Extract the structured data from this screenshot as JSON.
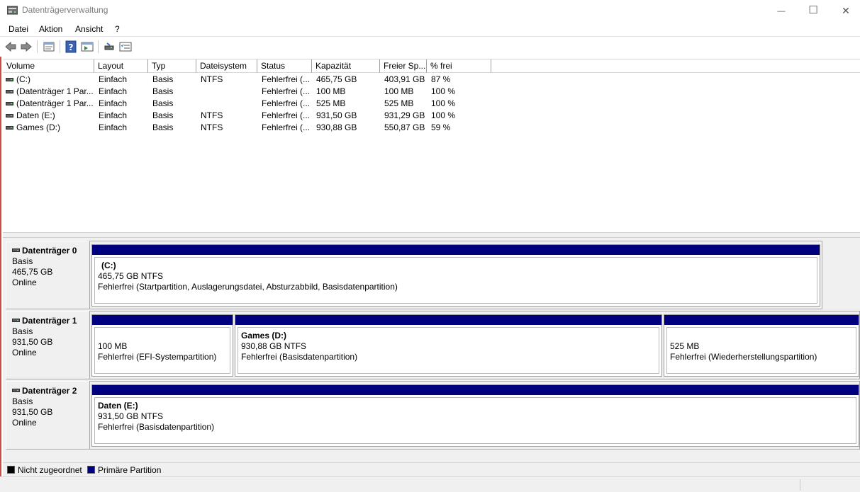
{
  "window": {
    "title": "Datenträgerverwaltung",
    "controls": {
      "minimize": "—",
      "maximize": "☐",
      "close": "✕"
    }
  },
  "menu": [
    {
      "label": "Datei"
    },
    {
      "label": "Aktion"
    },
    {
      "label": "Ansicht"
    },
    {
      "label": "?"
    }
  ],
  "toolbar": [
    "back-icon",
    "forward-icon",
    "properties-icon",
    "help-icon",
    "show-hide-console-tree-icon",
    "connect-icon",
    "checklist-icon"
  ],
  "volume_list": {
    "columns": [
      "Volume",
      "Layout",
      "Typ",
      "Dateisystem",
      "Status",
      "Kapazität",
      "Freier Sp...",
      "% frei"
    ],
    "rows": [
      {
        "volume": " (C:)",
        "layout": "Einfach",
        "typ": "Basis",
        "fs": "NTFS",
        "status": "Fehlerfrei (...",
        "capacity": "465,75 GB",
        "free": "403,91 GB",
        "pct": "87 %"
      },
      {
        "volume": "(Datenträger 1 Par...",
        "layout": "Einfach",
        "typ": "Basis",
        "fs": "",
        "status": "Fehlerfrei (...",
        "capacity": "100 MB",
        "free": "100 MB",
        "pct": "100 %"
      },
      {
        "volume": "(Datenträger 1 Par...",
        "layout": "Einfach",
        "typ": "Basis",
        "fs": "",
        "status": "Fehlerfrei (...",
        "capacity": "525 MB",
        "free": "525 MB",
        "pct": "100 %"
      },
      {
        "volume": "Daten (E:)",
        "layout": "Einfach",
        "typ": "Basis",
        "fs": "NTFS",
        "status": "Fehlerfrei (...",
        "capacity": "931,50 GB",
        "free": "931,29 GB",
        "pct": "100 %"
      },
      {
        "volume": "Games (D:)",
        "layout": "Einfach",
        "typ": "Basis",
        "fs": "NTFS",
        "status": "Fehlerfrei (...",
        "capacity": "930,88 GB",
        "free": "550,87 GB",
        "pct": "59 %"
      }
    ]
  },
  "disks": [
    {
      "name": "Datenträger 0",
      "type": "Basis",
      "size": "465,75 GB",
      "state": "Online",
      "partitions": [
        {
          "name": "(C:)",
          "size": "465,75 GB NTFS",
          "status": "Fehlerfrei (Startpartition, Auslagerungsdatei, Absturzabbild, Basisdatenpartition)"
        }
      ]
    },
    {
      "name": "Datenträger 1",
      "type": "Basis",
      "size": "931,50 GB",
      "state": "Online",
      "partitions": [
        {
          "name": "",
          "size": "100 MB",
          "status": "Fehlerfrei (EFI-Systempartition)"
        },
        {
          "name": "Games  (D:)",
          "size": "930,88 GB NTFS",
          "status": "Fehlerfrei (Basisdatenpartition)"
        },
        {
          "name": "",
          "size": "525 MB",
          "status": "Fehlerfrei (Wiederherstellungspartition)"
        }
      ]
    },
    {
      "name": "Datenträger 2",
      "type": "Basis",
      "size": "931,50 GB",
      "state": "Online",
      "partitions": [
        {
          "name": "Daten  (E:)",
          "size": "931,50 GB NTFS",
          "status": "Fehlerfrei (Basisdatenpartition)"
        }
      ]
    }
  ],
  "legend": [
    {
      "label": "Nicht zugeordnet",
      "color": "#000000"
    },
    {
      "label": "Primäre Partition",
      "color": "#00007e"
    }
  ],
  "colors": {
    "partition_bar": "#00007e",
    "accent": "#d04a4a"
  }
}
